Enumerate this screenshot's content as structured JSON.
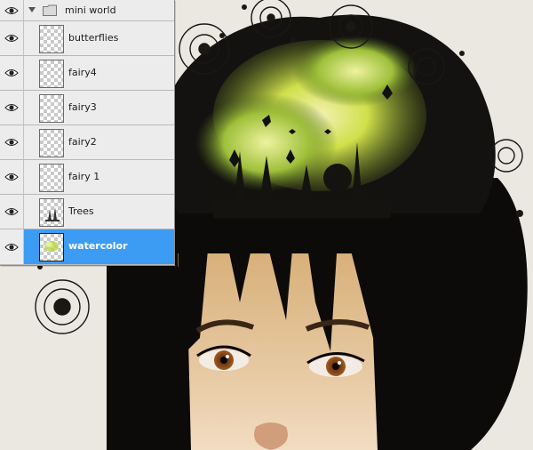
{
  "layers_panel": {
    "group": {
      "name": "mini world",
      "expanded": true,
      "visible": true
    },
    "layers": [
      {
        "name": "butterflies",
        "visible": true,
        "selected": false,
        "thumb": "empty"
      },
      {
        "name": "fairy4",
        "visible": true,
        "selected": false,
        "thumb": "empty"
      },
      {
        "name": "fairy3",
        "visible": true,
        "selected": false,
        "thumb": "empty"
      },
      {
        "name": "fairy2",
        "visible": true,
        "selected": false,
        "thumb": "empty"
      },
      {
        "name": "fairy 1",
        "visible": true,
        "selected": false,
        "thumb": "empty"
      },
      {
        "name": "Trees",
        "visible": true,
        "selected": false,
        "thumb": "trees"
      },
      {
        "name": "watercolor",
        "visible": true,
        "selected": true,
        "thumb": "watercolor"
      }
    ]
  },
  "theme": {
    "selected_row": "#3c9cf4",
    "panel_bg": "#ececec",
    "canvas_bg": "#e9e6df",
    "watercolor_green": "#c7d83a"
  },
  "icons": {
    "visibility": "eye-icon",
    "group": "folder-icon",
    "expand": "triangle-down-icon"
  }
}
